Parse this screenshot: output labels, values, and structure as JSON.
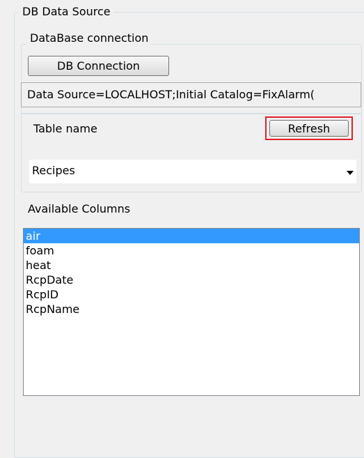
{
  "db_data_source": {
    "title": "DB Data Source",
    "connection_group": {
      "title": "DataBase connection",
      "button_label": "DB Connection",
      "connection_string": "Data Source=LOCALHOST;Initial Catalog=FixAlarm("
    },
    "table_group": {
      "label": "Table name",
      "refresh_label": "Refresh",
      "highlight_color": "#e0202c",
      "selected_table": "Recipes"
    },
    "columns": {
      "label": "Available Columns",
      "items": [
        "air",
        "foam",
        "heat",
        "RcpDate",
        "RcpID",
        "RcpName"
      ],
      "selected_index": 0,
      "selection_color": "#3399ff"
    }
  }
}
